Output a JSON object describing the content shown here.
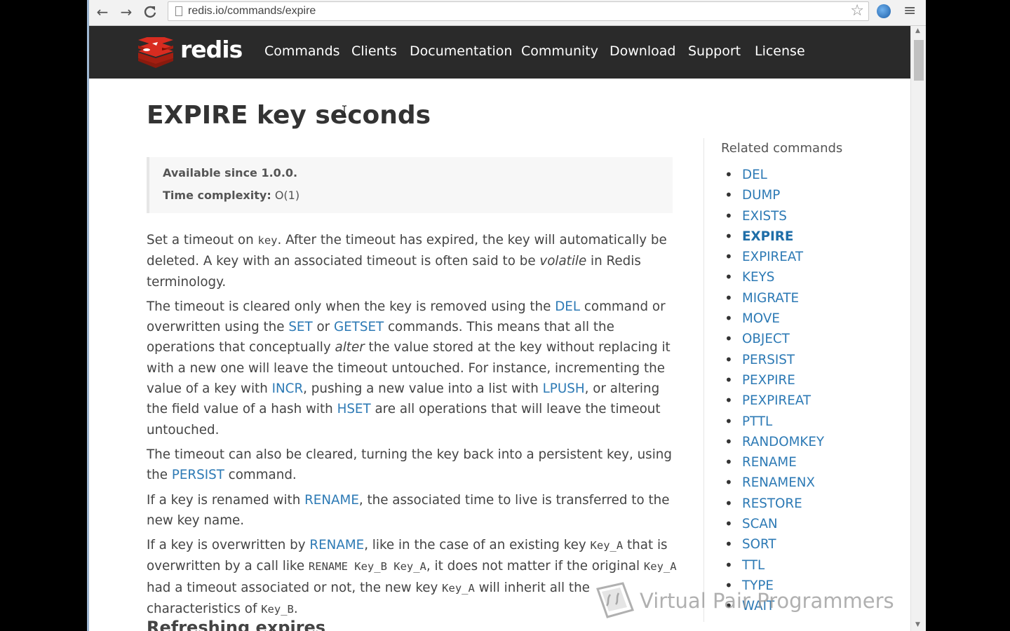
{
  "browser": {
    "url": "redis.io/commands/expire",
    "back_icon": "←",
    "forward_icon": "→",
    "reload_icon": "C",
    "star_icon": "☆",
    "menu_icon": "≡"
  },
  "header": {
    "brand": "redis",
    "nav": [
      "Commands",
      "Clients",
      "Documentation",
      "Community",
      "Download",
      "Support",
      "License"
    ]
  },
  "page": {
    "title": "EXPIRE key seconds",
    "meta": {
      "since_label": "Available since 1.0.0.",
      "complexity_label": "Time complexity:",
      "complexity_value": "O(1)"
    },
    "subheading": "Refreshing expires"
  },
  "paragraphs": [
    {
      "p1a": "Set a timeout on ",
      "p1code": "key",
      "p1b": ". After the timeout has expired, the key will automatically be deleted. A key with an associated timeout is often said to be ",
      "p1em": "volatile",
      "p1c": " in Redis terminology."
    },
    {
      "a": "The timeout is cleared only when the key is removed using the ",
      "del": "DEL",
      "b": " command or overwritten using the ",
      "set": "SET",
      "c": " or ",
      "getset": "GETSET",
      "d": " commands. This means that all the operations that conceptually ",
      "em": "alter",
      "e": " the value stored at the key without replacing it with a new one will leave the timeout untouched. For instance, incrementing the value of a key with ",
      "incr": "INCR",
      "f": ", pushing a new value into a list with ",
      "lpush": "LPUSH",
      "g": ", or altering the field value of a hash with ",
      "hset": "HSET",
      "h": " are all operations that will leave the timeout untouched."
    },
    {
      "a": "The timeout can also be cleared, turning the key back into a persistent key, using the ",
      "persist": "PERSIST",
      "b": " command."
    },
    {
      "a": "If a key is renamed with ",
      "rename": "RENAME",
      "b": ", the associated time to live is transferred to the new key name."
    },
    {
      "a": "If a key is overwritten by ",
      "rename": "RENAME",
      "b": ", like in the case of an existing key ",
      "code1": "Key_A",
      "c": " that is overwritten by a call like ",
      "code2": "RENAME Key_B Key_A",
      "d": ", it does not matter if the original ",
      "code3": "Key_A",
      "e": " had a timeout associated or not, the new key ",
      "code4": "Key_A",
      "f": " will inherit all the characteristics of ",
      "code5": "Key_B",
      "g": "."
    }
  ],
  "sidebar": {
    "title": "Related commands",
    "items": [
      "DEL",
      "DUMP",
      "EXISTS",
      "EXPIRE",
      "EXPIREAT",
      "KEYS",
      "MIGRATE",
      "MOVE",
      "OBJECT",
      "PERSIST",
      "PEXPIRE",
      "PEXPIREAT",
      "PTTL",
      "RANDOMKEY",
      "RENAME",
      "RENAMENX",
      "RESTORE",
      "SCAN",
      "SORT",
      "TTL",
      "TYPE",
      "WAIT"
    ],
    "current": "EXPIRE"
  },
  "watermark": {
    "text": "Virtual Pair Programmers"
  },
  "colors": {
    "link": "#2d7ab5",
    "header_bg": "#2a2a2a",
    "logo_red": "#d82c20"
  }
}
